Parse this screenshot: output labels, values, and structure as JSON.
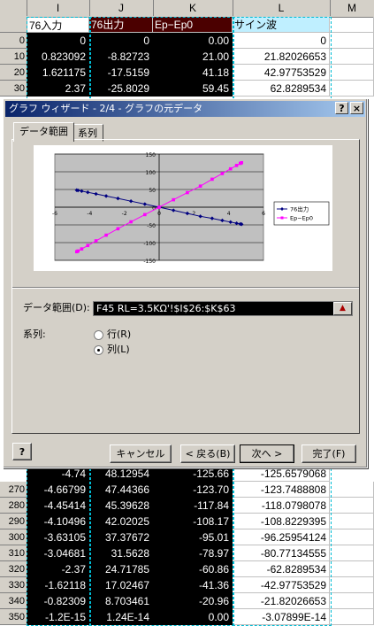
{
  "columns": [
    "I",
    "J",
    "K",
    "L",
    "M"
  ],
  "header_row": {
    "I": "76入力",
    "J": "76出力",
    "K": "Ep−Ep0",
    "L": "サイン波"
  },
  "top_rows": [
    {
      "row": "0",
      "I": "0",
      "J": "0",
      "K": "0.00",
      "L": "0"
    },
    {
      "row": "10",
      "I": "0.823092",
      "J": "-8.82723",
      "K": "21.00",
      "L": "21.82026653"
    },
    {
      "row": "20",
      "I": "1.621175",
      "J": "-17.5159",
      "K": "41.18",
      "L": "42.97753529"
    },
    {
      "row": "30",
      "I": "2.37",
      "J": "-25.8029",
      "K": "59.45",
      "L": "62.8289534"
    }
  ],
  "bottom_rows": [
    {
      "row": "270",
      "I": "-4.66799",
      "J": "47.44366",
      "K": "-123.70",
      "L": "-123.7488808"
    },
    {
      "row": "280",
      "I": "-4.45414",
      "J": "45.39628",
      "K": "-117.84",
      "L": "-118.0798078"
    },
    {
      "row": "290",
      "I": "-4.10496",
      "J": "42.02025",
      "K": "-108.17",
      "L": "-108.8229395"
    },
    {
      "row": "300",
      "I": "-3.63105",
      "J": "37.37672",
      "K": "-95.01",
      "L": "-96.25954124"
    },
    {
      "row": "310",
      "I": "-3.04681",
      "J": "31.5628",
      "K": "-78.97",
      "L": "-80.77134555"
    },
    {
      "row": "320",
      "I": "-2.37",
      "J": "24.71785",
      "K": "-60.86",
      "L": "-62.8289534"
    },
    {
      "row": "330",
      "I": "-1.62118",
      "J": "17.02467",
      "K": "-41.36",
      "L": "-42.97753529"
    },
    {
      "row": "340",
      "I": "-0.82309",
      "J": "8.703461",
      "K": "-20.96",
      "L": "-21.82026653"
    },
    {
      "row": "350",
      "I": "-1.2E-15",
      "J": "1.24E-14",
      "K": "0.00",
      "L": "-3.07899E-14"
    }
  ],
  "partial_row": {
    "I": "-4.74",
    "J": "48.12954",
    "K": "-125.66",
    "L": "-125.6579068"
  },
  "dialog": {
    "title": "グラフ ウィザード - 2/4 - グラフの元データ",
    "help_btn": "?",
    "close_btn": "×",
    "tabs": [
      "データ範囲",
      "系列"
    ],
    "range_label": "データ範囲(D):",
    "range_value": "F45 RL=3.5KΩ'!$I$26:$K$63",
    "series_label": "系列:",
    "radio_row": "行(R)",
    "radio_col": "列(L)",
    "buttons": {
      "cancel": "キャンセル",
      "back": "< 戻る(B)",
      "next": "次へ >",
      "finish": "完了(F)"
    },
    "wizard_icon": "?"
  },
  "chart_data": {
    "type": "scatter",
    "series": [
      {
        "name": "76出力",
        "color": "#000080",
        "marker": "diamond",
        "x": [
          0,
          0.823092,
          1.621175,
          2.37,
          3.04681,
          3.63105,
          4.10496,
          4.45414,
          4.66799,
          4.74,
          -0.82309,
          -1.62118,
          -2.37,
          -3.04681,
          -3.63105,
          -4.10496,
          -4.45414,
          -4.66799,
          -4.74
        ],
        "y": [
          0,
          -8.82723,
          -17.5159,
          -25.8029,
          -31.5628,
          -37.37672,
          -42.02025,
          -45.39628,
          -47.44366,
          -48.12954,
          8.703461,
          17.02467,
          24.71785,
          31.5628,
          37.37672,
          42.02025,
          45.39628,
          47.44366,
          48.12954
        ]
      },
      {
        "name": "Ep−Ep0",
        "color": "#ff00ff",
        "marker": "square",
        "x": [
          0,
          0.823092,
          1.621175,
          2.37,
          3.04681,
          3.63105,
          4.10496,
          4.45414,
          4.66799,
          4.74,
          -0.82309,
          -1.62118,
          -2.37,
          -3.04681,
          -3.63105,
          -4.10496,
          -4.45414,
          -4.66799,
          -4.74
        ],
        "y": [
          0,
          21.0,
          41.18,
          59.45,
          78.97,
          95.01,
          108.17,
          117.84,
          123.7,
          125.66,
          -20.96,
          -41.36,
          -60.86,
          -78.97,
          -95.01,
          -108.17,
          -117.84,
          -123.7,
          -125.66
        ]
      }
    ],
    "xlim": [
      -6,
      6
    ],
    "ylim": [
      -150,
      150
    ],
    "xticks": [
      "-6",
      "-4",
      "-2",
      "0",
      "2",
      "4",
      "6"
    ],
    "yticks": [
      "150",
      "100",
      "50",
      "0",
      "-50",
      "-100",
      "-150"
    ],
    "grid": true,
    "legend": "right"
  }
}
